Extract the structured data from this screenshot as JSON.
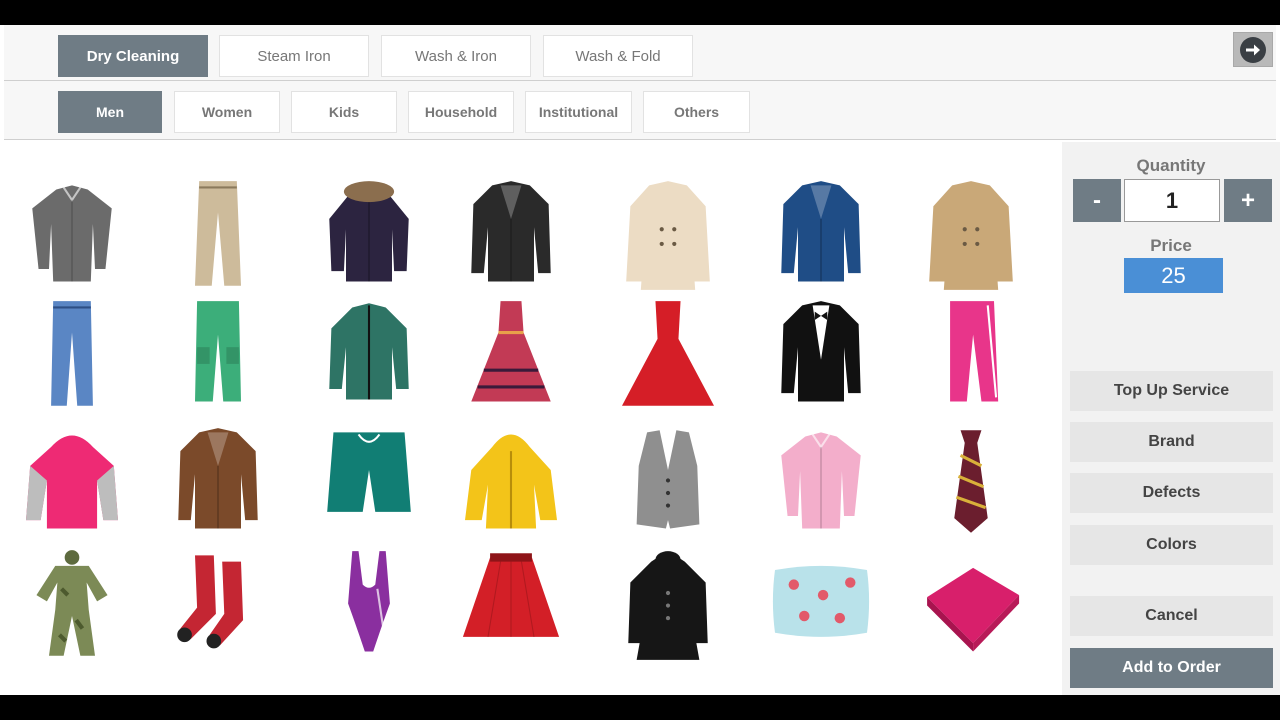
{
  "service_tabs": [
    {
      "label": "Dry Cleaning",
      "active": true
    },
    {
      "label": "Steam Iron",
      "active": false
    },
    {
      "label": "Wash & Iron",
      "active": false
    },
    {
      "label": "Wash & Fold",
      "active": false
    }
  ],
  "category_tabs": [
    {
      "label": "Men",
      "active": true
    },
    {
      "label": "Women",
      "active": false
    },
    {
      "label": "Kids",
      "active": false
    },
    {
      "label": "Household",
      "active": false
    },
    {
      "label": "Institutional",
      "active": false
    },
    {
      "label": "Others",
      "active": false
    }
  ],
  "next_icon": "arrow-right-circle-icon",
  "items": [
    {
      "icon": "shirt",
      "color": "#6b6b6b"
    },
    {
      "icon": "trousers",
      "color": "#cdbb9b"
    },
    {
      "icon": "parka",
      "color": "#2c2440"
    },
    {
      "icon": "blazer",
      "color": "#2a2a2a"
    },
    {
      "icon": "trench-coat",
      "color": "#ecdcc4"
    },
    {
      "icon": "blazer",
      "color": "#1f4d86"
    },
    {
      "icon": "trench-coat",
      "color": "#c9a878"
    },
    {
      "icon": "jeans",
      "color": "#5a86c4"
    },
    {
      "icon": "cargo-pants",
      "color": "#3cae7a"
    },
    {
      "icon": "jacket",
      "color": "#2e7465"
    },
    {
      "icon": "frock",
      "color": "#c23a55"
    },
    {
      "icon": "gown",
      "color": "#d51e27"
    },
    {
      "icon": "tuxedo",
      "color": "#111111"
    },
    {
      "icon": "track-pants",
      "color": "#e8358a"
    },
    {
      "icon": "hoodie",
      "color": "#ee2a74"
    },
    {
      "icon": "blazer",
      "color": "#7b4a2a"
    },
    {
      "icon": "shorts",
      "color": "#117e74"
    },
    {
      "icon": "raincoat",
      "color": "#f3c419"
    },
    {
      "icon": "waistcoat",
      "color": "#8f8f8f"
    },
    {
      "icon": "shirt",
      "color": "#f3aecb"
    },
    {
      "icon": "tie",
      "color": "#6b1e2e"
    },
    {
      "icon": "uniform",
      "color": "#7c8a56"
    },
    {
      "icon": "socks",
      "color": "#c42633"
    },
    {
      "icon": "swimsuit",
      "color": "#8a2f9f"
    },
    {
      "icon": "skirt",
      "color": "#d31f27"
    },
    {
      "icon": "long-coat",
      "color": "#161616"
    },
    {
      "icon": "pillow",
      "color": "#b9e2ea"
    },
    {
      "icon": "towel",
      "color": "#d81f6b"
    }
  ],
  "panel": {
    "quantity_label": "Quantity",
    "minus": "-",
    "quantity": "1",
    "plus": "+",
    "price_label": "Price",
    "price": "25",
    "top_up": "Top Up Service",
    "brand": "Brand",
    "defects": "Defects",
    "colors": "Colors",
    "cancel": "Cancel",
    "add_to_order": "Add to Order"
  }
}
